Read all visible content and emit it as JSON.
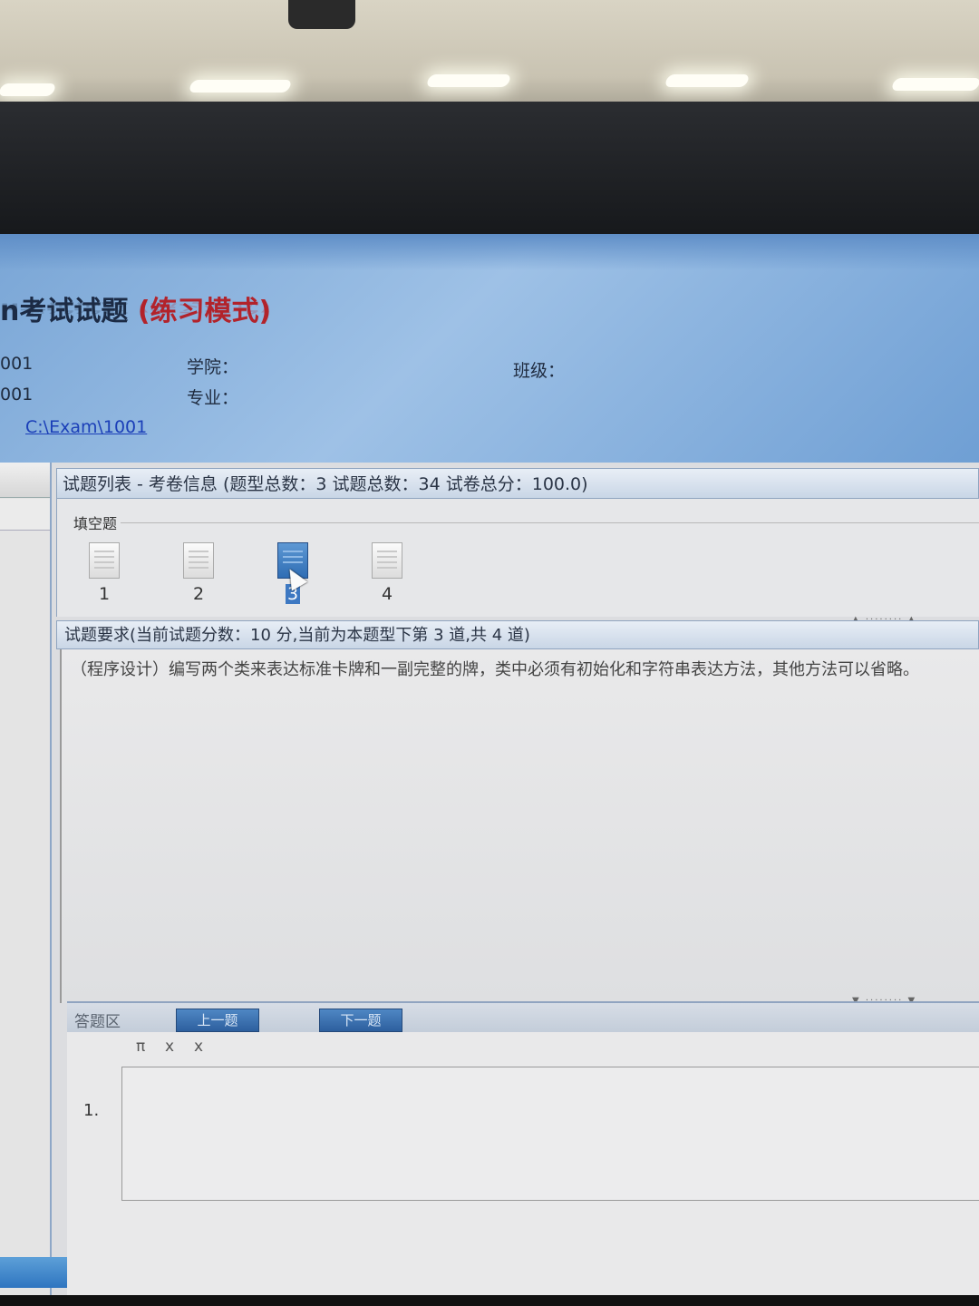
{
  "header": {
    "title_main": "n考试试题",
    "title_mode": "(练习模式)",
    "row1_left": "001",
    "row2_left": "001",
    "college_label": "学院：",
    "class_label": "班级：",
    "major_label": "专业：",
    "path": "C:\\Exam\\1001"
  },
  "question_list": {
    "bar_text": "试题列表 - 考卷信息 (题型总数：3  试题总数：34  试卷总分：100.0)",
    "section": "填空题",
    "items": [
      "1",
      "2",
      "3",
      "4"
    ],
    "active_index": 3
  },
  "requirement": {
    "bar_text": "试题要求(当前试题分数：10 分,当前为本题型下第 3 道,共 4 道)",
    "text": "（程序设计）编写两个类来表达标准卡牌和一副完整的牌，类中必须有初始化和字符串表达方法，其他方法可以省略。"
  },
  "answer": {
    "label": "答题区",
    "prev_button": "上一题",
    "next_button": "下一题",
    "tools": [
      "π",
      "x",
      "x"
    ],
    "item_index": "1."
  }
}
